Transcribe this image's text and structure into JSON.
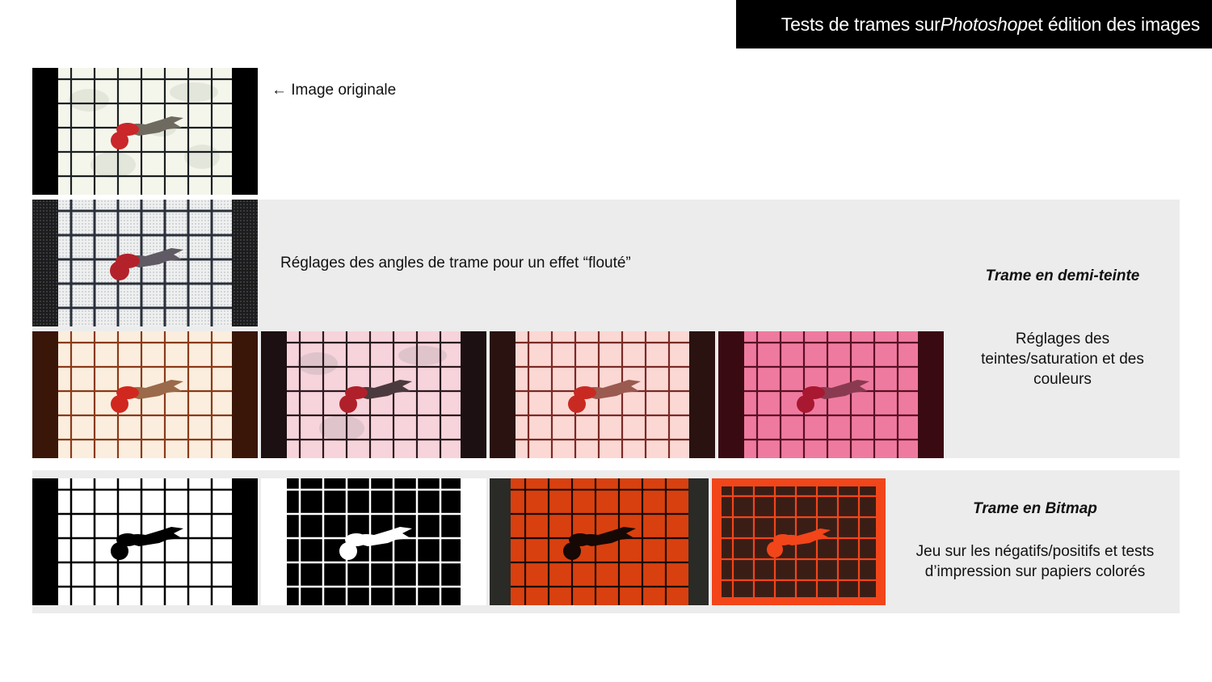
{
  "title": {
    "before": "Tests de trames sur ",
    "italic": "Photoshop",
    "after": " et édition des images"
  },
  "original": {
    "caption": "← Image originale"
  },
  "halftone": {
    "caption": "Réglages des angles de trame pour un effet “flouté”",
    "section_label": "Trame en demi-teinte",
    "hue_caption": "Réglages des teintes/saturation et des couleurs"
  },
  "bitmap": {
    "section_label": "Trame en Bitmap",
    "caption": "Jeu sur les négatifs/positifs et tests d’impression sur papiers colorés"
  },
  "colors": {
    "band": "#ececec",
    "title_bg": "#000000",
    "orange": "#d9400f",
    "pink": "#ef7aa0"
  }
}
